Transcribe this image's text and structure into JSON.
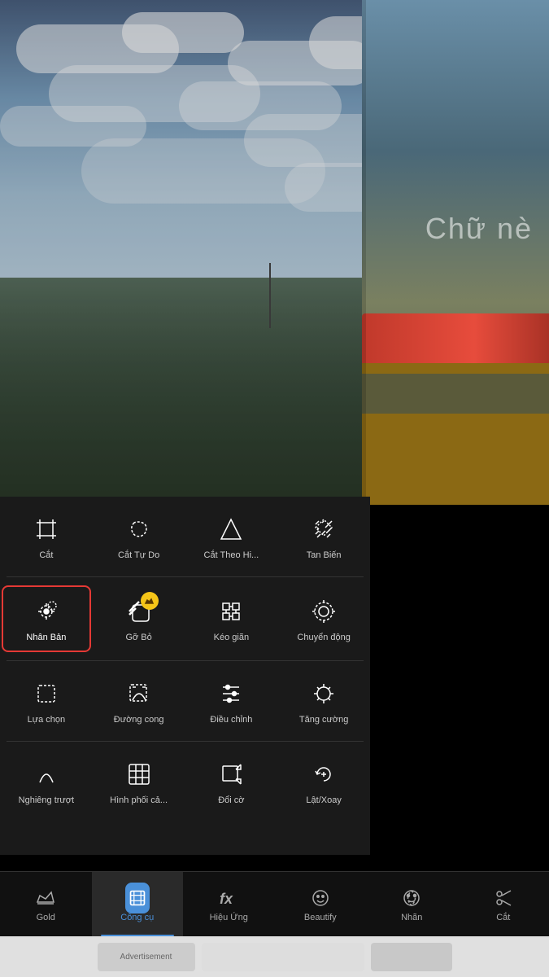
{
  "photo": {
    "overlay_text": "Chữ nè"
  },
  "tools": {
    "rows": [
      [
        {
          "id": "cat",
          "label": "Cắt",
          "icon": "crop",
          "selected": false,
          "premium": false
        },
        {
          "id": "cat-tu-do",
          "label": "Cắt Tự Do",
          "icon": "freehand-crop",
          "selected": false,
          "premium": false
        },
        {
          "id": "cat-theo-hi",
          "label": "Cắt Theo Hi...",
          "icon": "shape-crop",
          "selected": false,
          "premium": false
        },
        {
          "id": "tan-bien",
          "label": "Tan Biến",
          "icon": "dissolve",
          "selected": false,
          "premium": false
        }
      ],
      [
        {
          "id": "nhan-ban",
          "label": "Nhân Bản",
          "icon": "duplicate",
          "selected": true,
          "premium": false
        },
        {
          "id": "go-bo",
          "label": "Gỡ Bỏ",
          "icon": "remove-bg",
          "selected": false,
          "premium": true
        },
        {
          "id": "keo-gian",
          "label": "Kéo giãn",
          "icon": "stretch",
          "selected": false,
          "premium": false
        },
        {
          "id": "chuyen-dong",
          "label": "Chuyển động",
          "icon": "motion",
          "selected": false,
          "premium": false
        }
      ],
      [
        {
          "id": "lua-chon",
          "label": "Lựa chọn",
          "icon": "select",
          "selected": false,
          "premium": false
        },
        {
          "id": "duong-cong",
          "label": "Đường cong",
          "icon": "curve",
          "selected": false,
          "premium": false
        },
        {
          "id": "dieu-chinh",
          "label": "Điều chỉnh",
          "icon": "adjust",
          "selected": false,
          "premium": false
        },
        {
          "id": "tang-cuong",
          "label": "Tăng cường",
          "icon": "enhance",
          "selected": false,
          "premium": false
        }
      ],
      [
        {
          "id": "nghieng-truot",
          "label": "Nghiêng trượt",
          "icon": "tilt",
          "selected": false,
          "premium": false
        },
        {
          "id": "hinh-phoi-ca",
          "label": "Hình phối cả...",
          "icon": "blend",
          "selected": false,
          "premium": false
        },
        {
          "id": "doi-co",
          "label": "Đổi cờ",
          "icon": "resize",
          "selected": false,
          "premium": false
        },
        {
          "id": "lat-xoay",
          "label": "Lật/Xoay",
          "icon": "rotate",
          "selected": false,
          "premium": false
        }
      ]
    ]
  },
  "bottom_nav": {
    "items": [
      {
        "id": "gold",
        "label": "Gold",
        "icon": "crown",
        "active": false
      },
      {
        "id": "cong-cu",
        "label": "Công cụ",
        "icon": "crop-frame",
        "active": true
      },
      {
        "id": "hieu-ung",
        "label": "Hiệu Ứng",
        "icon": "fx",
        "active": false
      },
      {
        "id": "beautify",
        "label": "Beautify",
        "icon": "face",
        "active": false
      },
      {
        "id": "nhan",
        "label": "Nhãn",
        "icon": "sticker",
        "active": false
      },
      {
        "id": "cat-nav",
        "label": "Cắt",
        "icon": "scissors",
        "active": false
      }
    ]
  }
}
